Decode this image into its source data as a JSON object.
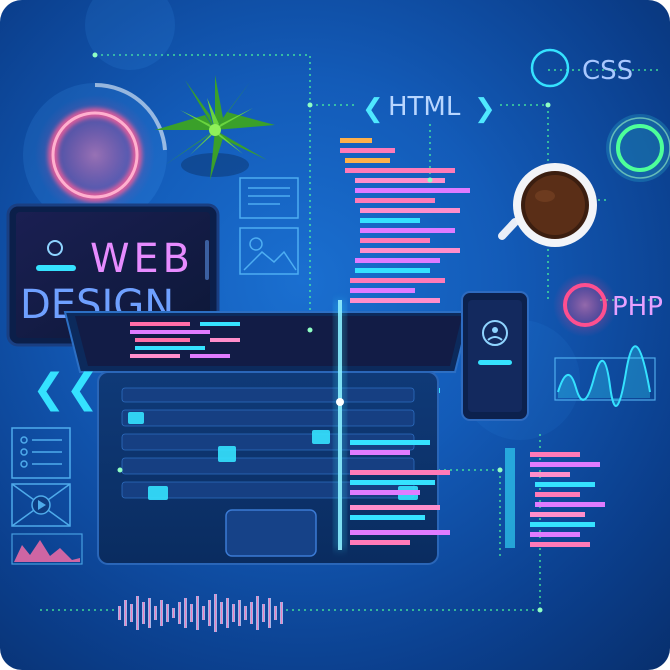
{
  "labels": {
    "tablet_line1": "WEB",
    "tablet_line2": "DESIGN",
    "html": "HTML",
    "html_left": "❮",
    "html_right": "❯",
    "css": "CSS",
    "php": "PHP",
    "back": "❮❮"
  },
  "colors": {
    "background_center": "#1a6fd0",
    "background_edge": "#082f6d",
    "neon_pink": "#ff3f86",
    "neon_cyan": "#35e2ff",
    "neon_green": "#4dff9a",
    "neon_purple": "#b36bff"
  }
}
